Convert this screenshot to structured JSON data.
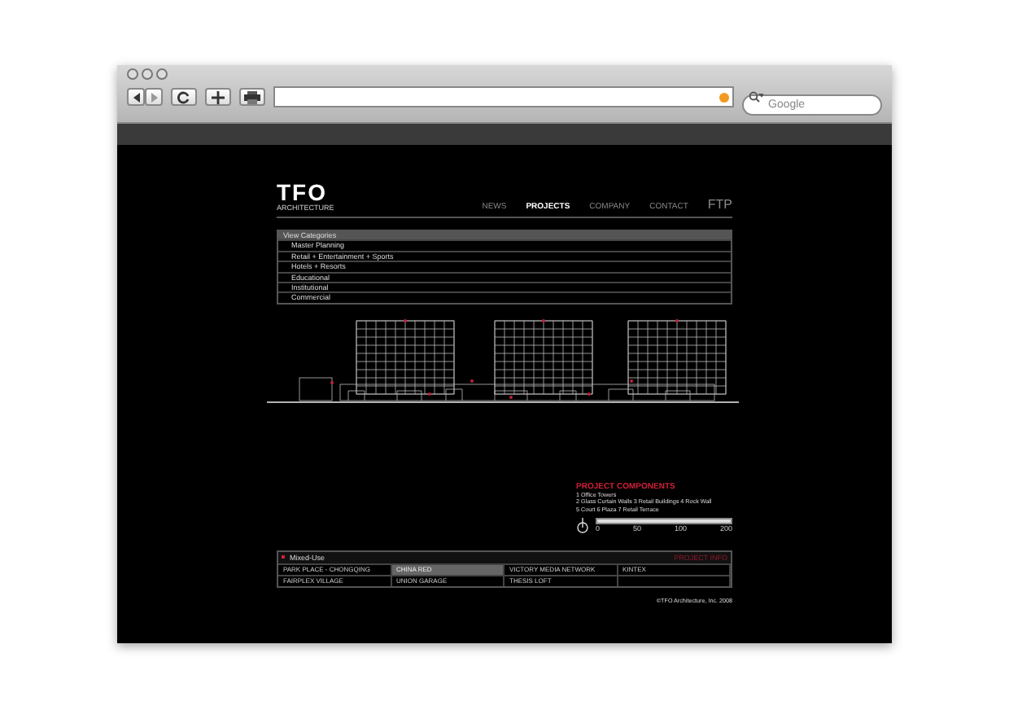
{
  "browser": {
    "search": {
      "placeholder": "Google"
    }
  },
  "site": {
    "logo": "TFO",
    "logo_sub": "ARCHITECTURE",
    "nav": [
      {
        "label": "NEWS",
        "selected": false
      },
      {
        "label": "PROJECTS",
        "selected": true
      },
      {
        "label": "COMPANY",
        "selected": false
      },
      {
        "label": "CONTACT",
        "selected": false
      },
      {
        "label": "FTP",
        "selected": false,
        "kind": "large"
      }
    ],
    "categories": [
      {
        "label": "View Categories",
        "selected": true
      },
      {
        "label": "Master Planning",
        "selected": false
      },
      {
        "label": "Retail + Entertainment + Sports",
        "selected": false
      },
      {
        "label": "Hotels + Resorts",
        "selected": false
      },
      {
        "label": "Educational",
        "selected": false
      },
      {
        "label": "Institutional",
        "selected": false
      },
      {
        "label": "Commercial",
        "selected": false
      }
    ],
    "components": {
      "title": "PROJECT COMPONENTS",
      "lines": [
        "1 Office Towers",
        "2 Glass Curtain Walls  3 Retail Buildings  4 Rock Wall",
        "5 Court  6 Plaza  7 Retail Terrace"
      ],
      "scale_ticks": [
        "0",
        "50",
        "100",
        "200"
      ]
    },
    "projects": {
      "category": "Mixed-Use",
      "info_link": "PROJECT INFO",
      "items": [
        {
          "label": "PARK PLACE - CHONGQING",
          "selected": false
        },
        {
          "label": "CHINA RED",
          "selected": true
        },
        {
          "label": "VICTORY MEDIA NETWORK",
          "selected": false
        },
        {
          "label": "KINTEX",
          "selected": false
        },
        {
          "label": "FAIRPLEX VILLAGE",
          "selected": false
        },
        {
          "label": "UNION GARAGE",
          "selected": false
        },
        {
          "label": "THESIS LOFT",
          "selected": false
        }
      ]
    },
    "footer": "©TFO Architecture, Inc. 2008"
  }
}
